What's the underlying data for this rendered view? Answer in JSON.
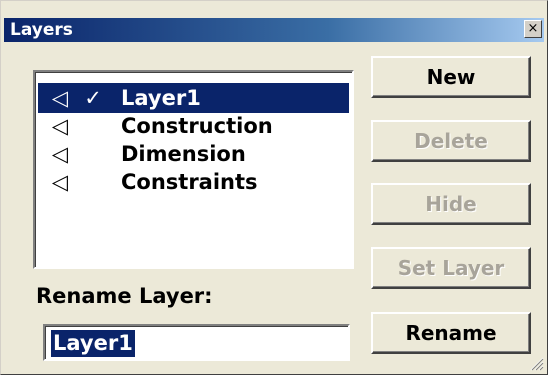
{
  "window": {
    "title": "Layers",
    "close_glyph": "×"
  },
  "layers": [
    {
      "name": "Layer1",
      "visible_icon": "eye-icon",
      "current": true,
      "selected": true
    },
    {
      "name": "Construction",
      "visible_icon": "eye-icon",
      "current": false,
      "selected": false
    },
    {
      "name": "Dimension",
      "visible_icon": "eye-icon",
      "current": false,
      "selected": false
    },
    {
      "name": "Constraints",
      "visible_icon": "eye-icon",
      "current": false,
      "selected": false
    }
  ],
  "glyphs": {
    "visible": "◁",
    "current_check": "✓"
  },
  "buttons": {
    "new": "New",
    "delete": "Delete",
    "hide": "Hide",
    "set_layer": "Set Layer",
    "rename": "Rename"
  },
  "button_state": {
    "new_enabled": true,
    "delete_enabled": false,
    "hide_enabled": false,
    "set_layer_enabled": false,
    "rename_enabled": true
  },
  "rename": {
    "label": "Rename Layer:",
    "value": "Layer1"
  },
  "colors": {
    "selection": "#0a246a",
    "dialog_bg": "#ece9d8",
    "disabled_text": "#a8a49a"
  }
}
